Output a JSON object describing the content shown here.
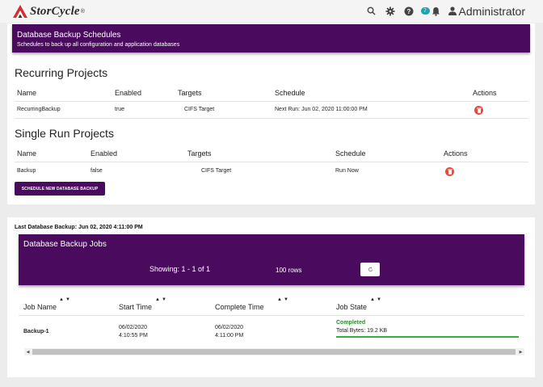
{
  "app": {
    "name": "StorCycle",
    "reg": "®"
  },
  "header": {
    "notification_count": "7",
    "user": "Administrator",
    "icons": [
      "search-icon",
      "gear-icon",
      "help-icon",
      "bell-icon",
      "user-icon"
    ]
  },
  "banner": {
    "title": "Database Backup Schedules",
    "subtitle": "Schedules to back up all configuration and application databases"
  },
  "recurring": {
    "title": "Recurring Projects",
    "columns": [
      "Name",
      "Enabled",
      "Targets",
      "Schedule",
      "Actions"
    ],
    "rows": [
      {
        "name": "RecurringBackup",
        "enabled": "true",
        "targets": "CIFS Target",
        "schedule": "Next Run: Jun 02, 2020 11:00:00 PM"
      }
    ]
  },
  "single": {
    "title": "Single Run Projects",
    "columns": [
      "Name",
      "Enabled",
      "Targets",
      "Schedule",
      "Actions"
    ],
    "rows": [
      {
        "name": "Backup",
        "enabled": "false",
        "targets": "CIFS Target",
        "schedule": "Run Now"
      }
    ]
  },
  "schedule_button": "SCHEDULE NEW DATABASE BACKUP",
  "last_backup": "Last Database Backup: Jun 02, 2020 4:11:00 PM",
  "jobs": {
    "title": "Database Backup Jobs",
    "showing": "Showing: 1 - 1 of 1",
    "rows_per_page": "100 rows",
    "refresh_icon": "refresh-icon",
    "columns": [
      "Job Name",
      "Start Time",
      "Complete Time",
      "Job State"
    ],
    "rows": [
      {
        "name": "Backup-1",
        "start_date": "06/02/2020",
        "start_time": "4:10:55 PM",
        "complete_date": "06/02/2020",
        "complete_time": "4:11:00 PM",
        "state": "Completed",
        "bytes": "Total Bytes: 19.2 KB",
        "progress": 1.0
      }
    ]
  },
  "colors": {
    "banner": "#4a0a5e",
    "delete": "#e84b3c",
    "success": "#2e8b2e",
    "badge": "#1aa6b7"
  }
}
